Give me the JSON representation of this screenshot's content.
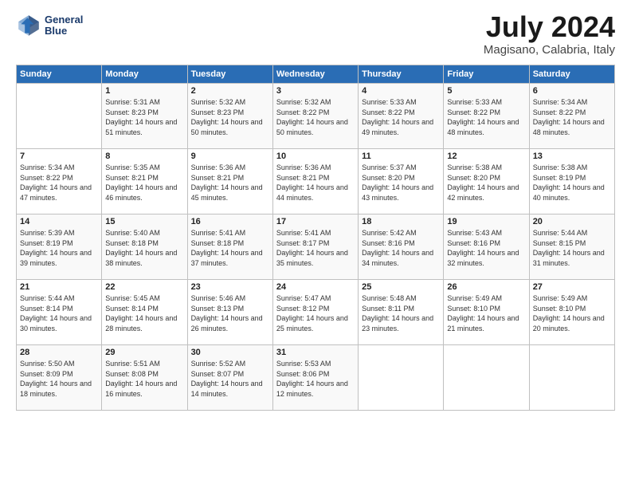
{
  "logo": {
    "line1": "General",
    "line2": "Blue"
  },
  "title": {
    "month_year": "July 2024",
    "location": "Magisano, Calabria, Italy"
  },
  "headers": [
    "Sunday",
    "Monday",
    "Tuesday",
    "Wednesday",
    "Thursday",
    "Friday",
    "Saturday"
  ],
  "weeks": [
    [
      {
        "day": "",
        "sunrise": "",
        "sunset": "",
        "daylight": ""
      },
      {
        "day": "1",
        "sunrise": "Sunrise: 5:31 AM",
        "sunset": "Sunset: 8:23 PM",
        "daylight": "Daylight: 14 hours and 51 minutes."
      },
      {
        "day": "2",
        "sunrise": "Sunrise: 5:32 AM",
        "sunset": "Sunset: 8:23 PM",
        "daylight": "Daylight: 14 hours and 50 minutes."
      },
      {
        "day": "3",
        "sunrise": "Sunrise: 5:32 AM",
        "sunset": "Sunset: 8:22 PM",
        "daylight": "Daylight: 14 hours and 50 minutes."
      },
      {
        "day": "4",
        "sunrise": "Sunrise: 5:33 AM",
        "sunset": "Sunset: 8:22 PM",
        "daylight": "Daylight: 14 hours and 49 minutes."
      },
      {
        "day": "5",
        "sunrise": "Sunrise: 5:33 AM",
        "sunset": "Sunset: 8:22 PM",
        "daylight": "Daylight: 14 hours and 48 minutes."
      },
      {
        "day": "6",
        "sunrise": "Sunrise: 5:34 AM",
        "sunset": "Sunset: 8:22 PM",
        "daylight": "Daylight: 14 hours and 48 minutes."
      }
    ],
    [
      {
        "day": "7",
        "sunrise": "Sunrise: 5:34 AM",
        "sunset": "Sunset: 8:22 PM",
        "daylight": "Daylight: 14 hours and 47 minutes."
      },
      {
        "day": "8",
        "sunrise": "Sunrise: 5:35 AM",
        "sunset": "Sunset: 8:21 PM",
        "daylight": "Daylight: 14 hours and 46 minutes."
      },
      {
        "day": "9",
        "sunrise": "Sunrise: 5:36 AM",
        "sunset": "Sunset: 8:21 PM",
        "daylight": "Daylight: 14 hours and 45 minutes."
      },
      {
        "day": "10",
        "sunrise": "Sunrise: 5:36 AM",
        "sunset": "Sunset: 8:21 PM",
        "daylight": "Daylight: 14 hours and 44 minutes."
      },
      {
        "day": "11",
        "sunrise": "Sunrise: 5:37 AM",
        "sunset": "Sunset: 8:20 PM",
        "daylight": "Daylight: 14 hours and 43 minutes."
      },
      {
        "day": "12",
        "sunrise": "Sunrise: 5:38 AM",
        "sunset": "Sunset: 8:20 PM",
        "daylight": "Daylight: 14 hours and 42 minutes."
      },
      {
        "day": "13",
        "sunrise": "Sunrise: 5:38 AM",
        "sunset": "Sunset: 8:19 PM",
        "daylight": "Daylight: 14 hours and 40 minutes."
      }
    ],
    [
      {
        "day": "14",
        "sunrise": "Sunrise: 5:39 AM",
        "sunset": "Sunset: 8:19 PM",
        "daylight": "Daylight: 14 hours and 39 minutes."
      },
      {
        "day": "15",
        "sunrise": "Sunrise: 5:40 AM",
        "sunset": "Sunset: 8:18 PM",
        "daylight": "Daylight: 14 hours and 38 minutes."
      },
      {
        "day": "16",
        "sunrise": "Sunrise: 5:41 AM",
        "sunset": "Sunset: 8:18 PM",
        "daylight": "Daylight: 14 hours and 37 minutes."
      },
      {
        "day": "17",
        "sunrise": "Sunrise: 5:41 AM",
        "sunset": "Sunset: 8:17 PM",
        "daylight": "Daylight: 14 hours and 35 minutes."
      },
      {
        "day": "18",
        "sunrise": "Sunrise: 5:42 AM",
        "sunset": "Sunset: 8:16 PM",
        "daylight": "Daylight: 14 hours and 34 minutes."
      },
      {
        "day": "19",
        "sunrise": "Sunrise: 5:43 AM",
        "sunset": "Sunset: 8:16 PM",
        "daylight": "Daylight: 14 hours and 32 minutes."
      },
      {
        "day": "20",
        "sunrise": "Sunrise: 5:44 AM",
        "sunset": "Sunset: 8:15 PM",
        "daylight": "Daylight: 14 hours and 31 minutes."
      }
    ],
    [
      {
        "day": "21",
        "sunrise": "Sunrise: 5:44 AM",
        "sunset": "Sunset: 8:14 PM",
        "daylight": "Daylight: 14 hours and 30 minutes."
      },
      {
        "day": "22",
        "sunrise": "Sunrise: 5:45 AM",
        "sunset": "Sunset: 8:14 PM",
        "daylight": "Daylight: 14 hours and 28 minutes."
      },
      {
        "day": "23",
        "sunrise": "Sunrise: 5:46 AM",
        "sunset": "Sunset: 8:13 PM",
        "daylight": "Daylight: 14 hours and 26 minutes."
      },
      {
        "day": "24",
        "sunrise": "Sunrise: 5:47 AM",
        "sunset": "Sunset: 8:12 PM",
        "daylight": "Daylight: 14 hours and 25 minutes."
      },
      {
        "day": "25",
        "sunrise": "Sunrise: 5:48 AM",
        "sunset": "Sunset: 8:11 PM",
        "daylight": "Daylight: 14 hours and 23 minutes."
      },
      {
        "day": "26",
        "sunrise": "Sunrise: 5:49 AM",
        "sunset": "Sunset: 8:10 PM",
        "daylight": "Daylight: 14 hours and 21 minutes."
      },
      {
        "day": "27",
        "sunrise": "Sunrise: 5:49 AM",
        "sunset": "Sunset: 8:10 PM",
        "daylight": "Daylight: 14 hours and 20 minutes."
      }
    ],
    [
      {
        "day": "28",
        "sunrise": "Sunrise: 5:50 AM",
        "sunset": "Sunset: 8:09 PM",
        "daylight": "Daylight: 14 hours and 18 minutes."
      },
      {
        "day": "29",
        "sunrise": "Sunrise: 5:51 AM",
        "sunset": "Sunset: 8:08 PM",
        "daylight": "Daylight: 14 hours and 16 minutes."
      },
      {
        "day": "30",
        "sunrise": "Sunrise: 5:52 AM",
        "sunset": "Sunset: 8:07 PM",
        "daylight": "Daylight: 14 hours and 14 minutes."
      },
      {
        "day": "31",
        "sunrise": "Sunrise: 5:53 AM",
        "sunset": "Sunset: 8:06 PM",
        "daylight": "Daylight: 14 hours and 12 minutes."
      },
      {
        "day": "",
        "sunrise": "",
        "sunset": "",
        "daylight": ""
      },
      {
        "day": "",
        "sunrise": "",
        "sunset": "",
        "daylight": ""
      },
      {
        "day": "",
        "sunrise": "",
        "sunset": "",
        "daylight": ""
      }
    ]
  ]
}
